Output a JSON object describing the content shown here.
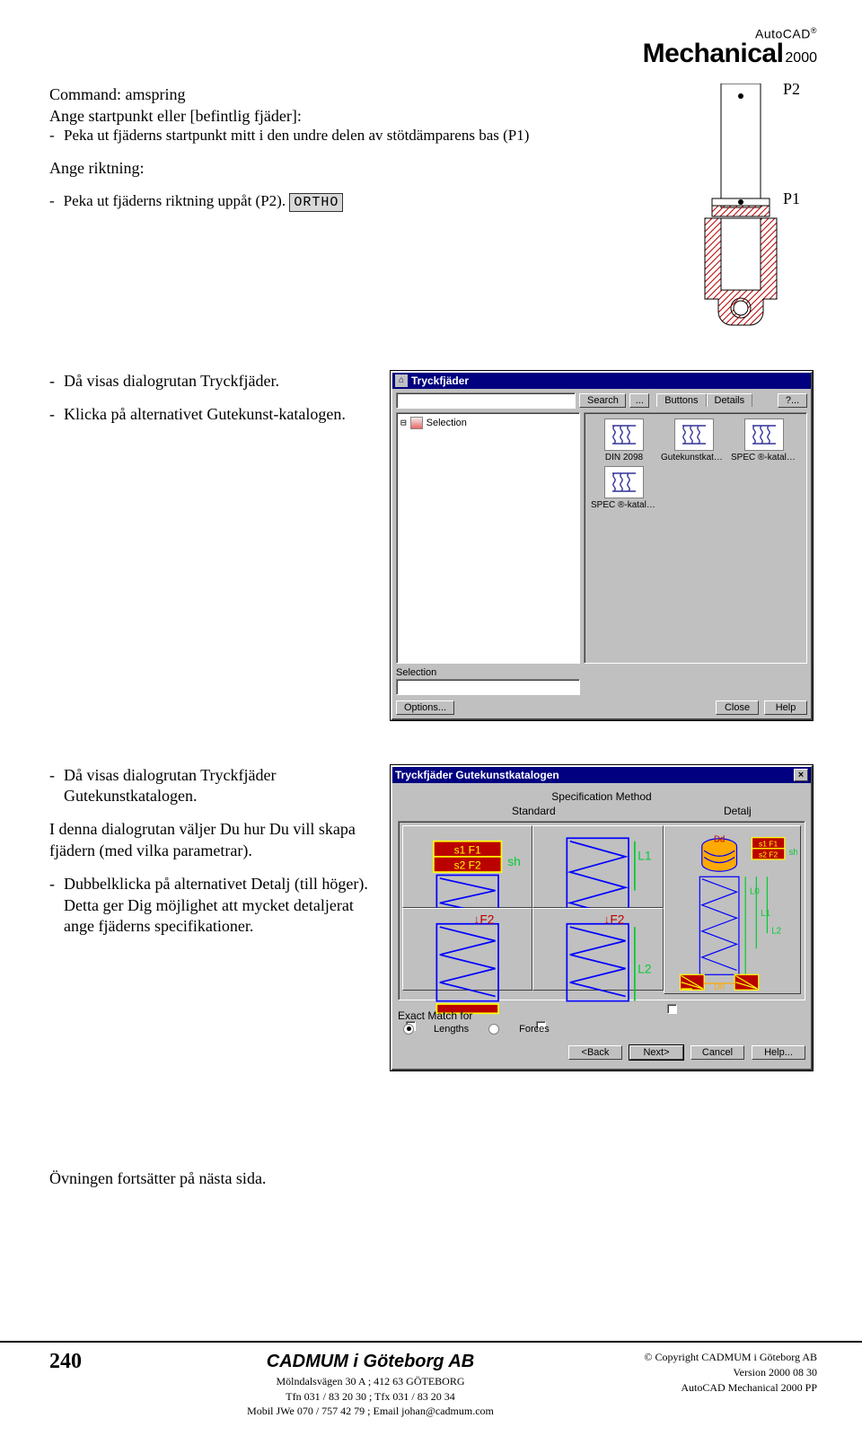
{
  "brand": {
    "top": "AutoCAD",
    "reg": "®",
    "main": "Mechanical",
    "year": "2000"
  },
  "sec1": {
    "line1": "Command: amspring",
    "line2": "Ange startpunkt eller [befintlig fjäder]:",
    "b1": "Peka ut fjäderns startpunkt mitt i den undre delen av stötdämparens bas (P1)",
    "line3": "Ange riktning:",
    "b2": "Peka ut fjäderns riktning uppåt (P2).",
    "ortho": "ORTHO",
    "p1": "P1",
    "p2": "P2"
  },
  "sec2": {
    "b1": "Då visas dialogrutan Tryckfjäder.",
    "b2": "Klicka på alternativet Gutekunst-katalogen."
  },
  "dlg1": {
    "title": "Tryckfjäder",
    "search": "Search",
    "dots": "...",
    "tab1": "Buttons",
    "tab2": "Details",
    "qmark": "?...",
    "tree_item": "Selection",
    "cells": [
      "DIN 2098",
      "Gutekunstkatalo...",
      "SPEC ®-katalog B",
      "SPEC ®-katalog A"
    ],
    "sel_label": "Selection",
    "options": "Options...",
    "close": "Close",
    "help": "Help"
  },
  "sec3": {
    "p1": "Då visas dialogrutan Tryckfjäder Gutekunstkatalogen.",
    "p2": "I denna dialogrutan väljer Du hur Du vill skapa fjädern (med vilka parametrar).",
    "p3": "Dubbelklicka på alternativet Detalj (till höger). Detta ger Dig möjlighet att mycket detaljerat ange fjäderns specifikationer."
  },
  "dlg2": {
    "title": "Tryckfjäder Gutekunstkatalogen",
    "subtitle": "Specification Method",
    "col1": "Standard",
    "col2": "Detalj",
    "exact": "Exact Match for",
    "r1": "Lengths",
    "r2": "Forces",
    "back": "<Back",
    "next": "Next>",
    "cancel": "Cancel",
    "help": "Help..."
  },
  "continue": "Övningen fortsätter på nästa sida.",
  "footer": {
    "page": "240",
    "company": "CADMUM i Göteborg AB",
    "addr": "Mölndalsvägen 30 A ; 412 63 GÖTEBORG",
    "phone": "Tfn 031 / 83 20 30 ; Tfx 031 / 83 20 34",
    "mobile": "Mobil JWe 070 / 757 42 79 ; Email johan@cadmum.com",
    "copy": "© Copyright CADMUM i Göteborg AB",
    "ver": "Version 2000 08 30",
    "prod": "AutoCAD Mechanical 2000 PP"
  }
}
